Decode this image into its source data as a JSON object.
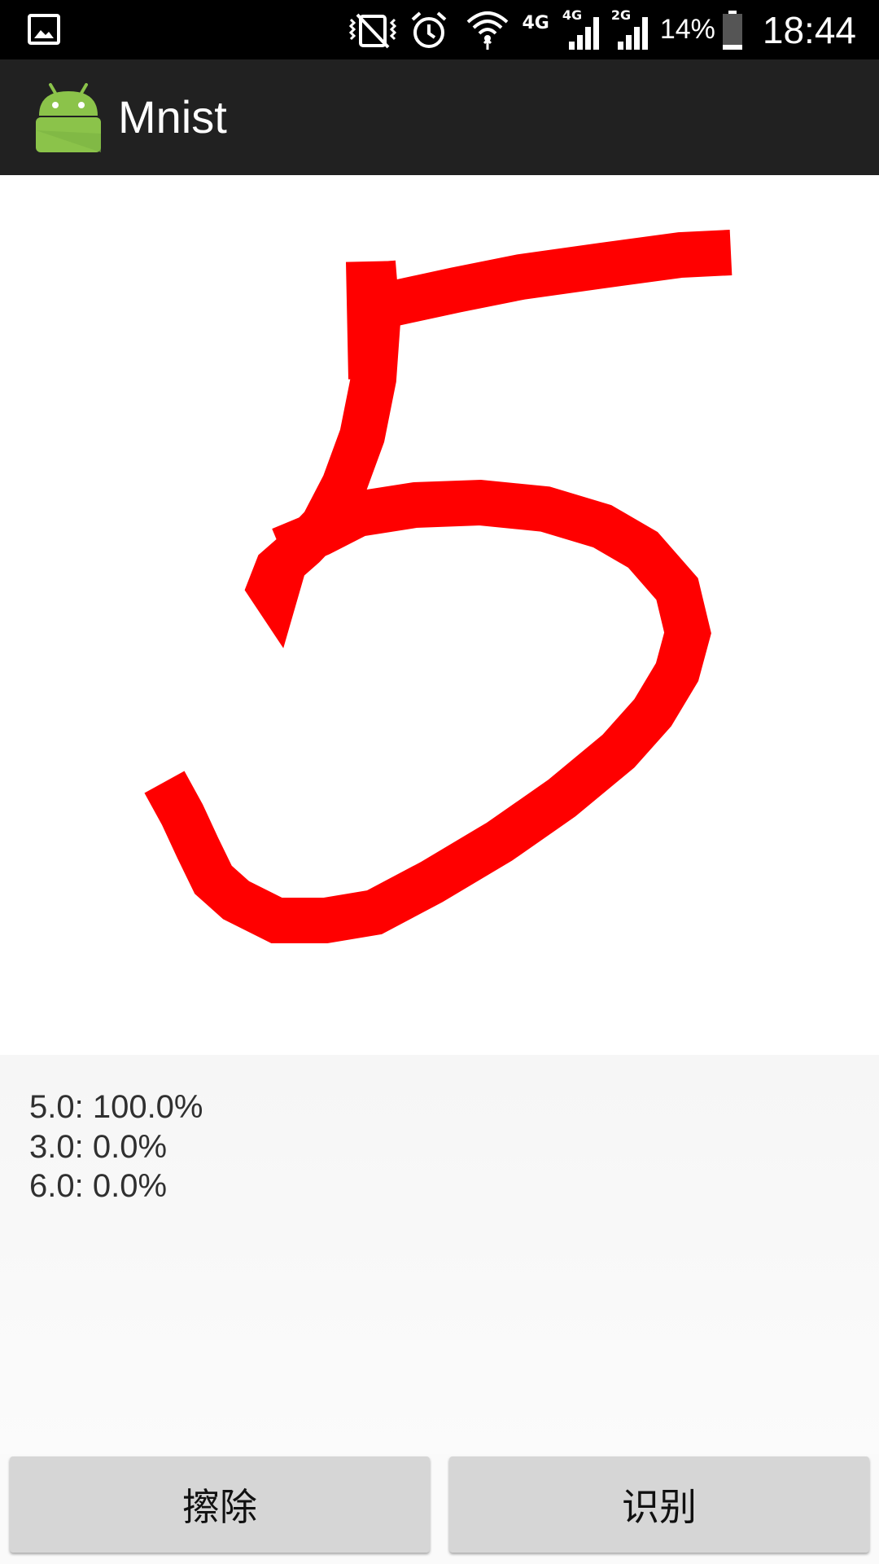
{
  "status_bar": {
    "network_4g": "4G",
    "signal_4g_label": "4G",
    "signal_2g_label": "2G",
    "battery_percent": "14%",
    "time": "18:44",
    "icons": [
      "gallery-icon",
      "vibrate-icon",
      "alarm-icon",
      "wifi-icon",
      "signal-icon",
      "battery-icon"
    ]
  },
  "action_bar": {
    "title": "Mnist",
    "icon": "android-icon"
  },
  "canvas": {
    "stroke_color": "#ff0000",
    "background_color": "#ffffff"
  },
  "results": {
    "lines": [
      "5.0: 100.0%",
      "3.0: 0.0%",
      "6.0: 0.0%"
    ]
  },
  "buttons": {
    "erase_label": "擦除",
    "recognize_label": "识别"
  }
}
